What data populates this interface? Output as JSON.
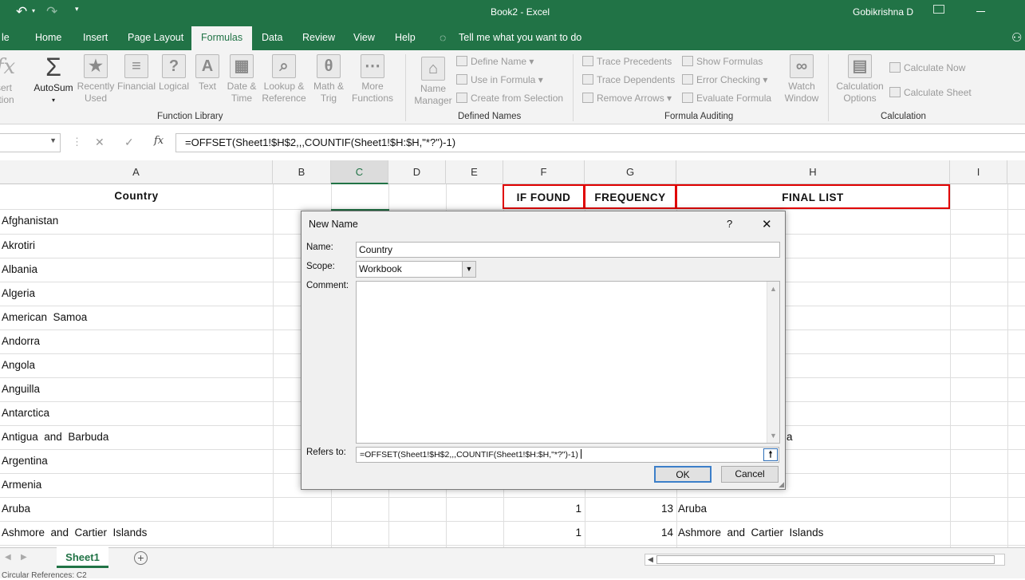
{
  "titlebar": {
    "file_title": "Book2 - Excel",
    "user": "Gobikrishna D"
  },
  "menu": {
    "tabs": [
      "le",
      "Home",
      "Insert",
      "Page Layout",
      "Formulas",
      "Data",
      "Review",
      "View",
      "Help"
    ],
    "active": "Formulas",
    "tell_me": "Tell me what you want to do"
  },
  "ribbon": {
    "insert_function": [
      "sert",
      "ction"
    ],
    "autosum": "AutoSum",
    "recently_used": [
      "Recently",
      "Used"
    ],
    "financial": "Financial",
    "logical": "Logical",
    "text": "Text",
    "date_time": [
      "Date &",
      "Time"
    ],
    "lookup": [
      "Lookup &",
      "Reference"
    ],
    "math": [
      "Math &",
      "Trig"
    ],
    "more": [
      "More",
      "Functions"
    ],
    "group_function_library": "Function Library",
    "name_manager": [
      "Name",
      "Manager"
    ],
    "define_name": "Define Name",
    "use_in_formula": "Use in Formula",
    "create_from_selection": "Create from Selection",
    "group_defined_names": "Defined Names",
    "trace_precedents": "Trace Precedents",
    "trace_dependents": "Trace Dependents",
    "remove_arrows": "Remove Arrows",
    "show_formulas": "Show Formulas",
    "error_checking": "Error Checking",
    "evaluate_formula": "Evaluate Formula",
    "watch_window": [
      "Watch",
      "Window"
    ],
    "group_formula_auditing": "Formula Auditing",
    "calc_options": [
      "Calculation",
      "Options"
    ],
    "calc_now": "Calculate Now",
    "calc_sheet": "Calculate Sheet",
    "group_calculation": "Calculation",
    "icon_names": {
      "autosum": "sigma-icon",
      "fx": "fx-icon"
    }
  },
  "formula_bar": {
    "fx": "fx",
    "cancel": "✕",
    "enter": "✓",
    "formula": "=OFFSET(Sheet1!$H$2,,,COUNTIF(Sheet1!$H:$H,\"*?\")-1)"
  },
  "columns": [
    "A",
    "B",
    "C",
    "D",
    "E",
    "F",
    "G",
    "H",
    "I"
  ],
  "header_row": {
    "a": "Country",
    "f": "IF  FOUND",
    "g": "FREQUENCY",
    "h": "FINAL  LIST"
  },
  "countries": [
    "Afghanistan",
    "Akrotiri",
    "Albania",
    "Algeria",
    "American  Samoa",
    "Andorra",
    "Angola",
    "Anguilla",
    "Antarctica",
    "Antigua  and  Barbuda",
    "Argentina",
    "Armenia",
    "Aruba",
    "Ashmore  and  Cartier  Islands"
  ],
  "partial": {
    "row10_h": "a"
  },
  "row_aruba": {
    "f": "1",
    "g": "13",
    "h": "Aruba"
  },
  "row_ashmore": {
    "f": "1",
    "g": "14",
    "h": "Ashmore  and  Cartier  Islands"
  },
  "dialog": {
    "title": "New Name",
    "help": "?",
    "close": "✕",
    "name_label": "Name:",
    "name_value": "Country",
    "scope_label": "Scope:",
    "scope_value": "Workbook",
    "comment_label": "Comment:",
    "refers_label": "Refers to:",
    "refers_value": "=OFFSET(Sheet1!$H$2,,,COUNTIF(Sheet1!$H:$H,\"*?\")-1)",
    "ok": "OK",
    "cancel": "Cancel"
  },
  "sheet_tabs": {
    "active": "Sheet1",
    "add": "+"
  },
  "status": {
    "text": "Circular References: C2"
  },
  "colors": {
    "excel_green": "#217346",
    "highlight_red": "#e00000"
  }
}
